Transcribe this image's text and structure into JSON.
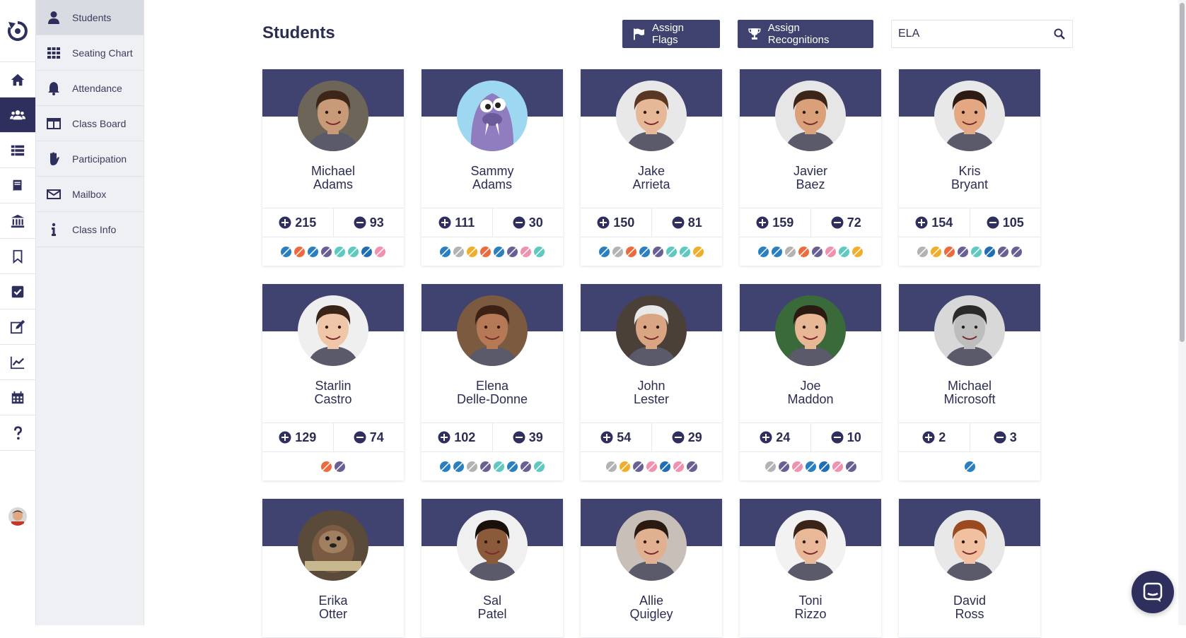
{
  "rail": {
    "items": [
      "home-icon",
      "students-icon",
      "list-icon",
      "book-icon",
      "bank-icon",
      "bookmark-icon",
      "checkbox-icon",
      "edit-icon",
      "chart-icon",
      "calendar-icon",
      "help-icon"
    ],
    "active": "students-icon"
  },
  "subnav": {
    "items": [
      {
        "label": "Students",
        "icon": "person-icon",
        "active": true
      },
      {
        "label": "Seating Chart",
        "icon": "grid-icon"
      },
      {
        "label": "Attendance",
        "icon": "bell-icon"
      },
      {
        "label": "Class Board",
        "icon": "board-icon"
      },
      {
        "label": "Participation",
        "icon": "hand-icon"
      },
      {
        "label": "Mailbox",
        "icon": "mail-icon"
      },
      {
        "label": "Class Info",
        "icon": "info-icon"
      }
    ]
  },
  "header": {
    "title": "Students",
    "assign_flags": "Assign Flags",
    "assign_recognitions": "Assign Recognitions",
    "search_value": "ELA"
  },
  "colors": {
    "navy": "#40426f",
    "dark": "#2f2f5e",
    "b": "#2a7fc1",
    "o": "#ee6a3c",
    "p": "#6a5f95",
    "t": "#5ec9c0",
    "d": "#1f6db5",
    "k": "#f091ae",
    "g": "#b3b3b3",
    "y": "#f2ad2b"
  },
  "students": [
    {
      "first": "Michael",
      "last": "Adams",
      "plus": "215",
      "minus": "93",
      "badges": [
        "b",
        "o",
        "b",
        "p",
        "t",
        "t",
        "d",
        "k"
      ],
      "skin": "#c89a78",
      "hair": "#3d2518",
      "bg": "#6d6658"
    },
    {
      "first": "Sammy",
      "last": "Adams",
      "plus": "111",
      "minus": "30",
      "badges": [
        "b",
        "g",
        "y",
        "o",
        "b",
        "p",
        "k",
        "t"
      ],
      "mascot": true
    },
    {
      "first": "Jake",
      "last": "Arrieta",
      "plus": "150",
      "minus": "81",
      "badges": [
        "b",
        "g",
        "o",
        "b",
        "p",
        "t",
        "t",
        "y"
      ],
      "skin": "#e7b898",
      "hair": "#5a3722",
      "bg": "#e8e8e8"
    },
    {
      "first": "Javier",
      "last": "Baez",
      "plus": "159",
      "minus": "72",
      "badges": [
        "b",
        "b",
        "g",
        "o",
        "p",
        "k",
        "t",
        "y"
      ],
      "skin": "#d9a07a",
      "hair": "#3b2418",
      "bg": "#e6e6e6"
    },
    {
      "first": "Kris",
      "last": "Bryant",
      "plus": "154",
      "minus": "105",
      "badges": [
        "g",
        "y",
        "o",
        "p",
        "t",
        "d",
        "p",
        "p"
      ],
      "skin": "#e3a882",
      "hair": "#2d1a12",
      "bg": "#e8e8e8"
    },
    {
      "first": "Starlin",
      "last": "Castro",
      "plus": "129",
      "minus": "74",
      "badges": [
        "o",
        "p"
      ],
      "skin": "#f0c6a8",
      "hair": "#3a2418",
      "bg": "#efefef"
    },
    {
      "first": "Elena",
      "last": "Delle-Donne",
      "plus": "102",
      "minus": "39",
      "badges": [
        "b",
        "b",
        "g",
        "p",
        "t",
        "b",
        "p",
        "t"
      ],
      "skin": "#b57a55",
      "hair": "#3b2214",
      "bg": "#7b5a40"
    },
    {
      "first": "John",
      "last": "Lester",
      "plus": "54",
      "minus": "29",
      "badges": [
        "g",
        "y",
        "p",
        "k",
        "d",
        "k",
        "p"
      ],
      "skin": "#d9a582",
      "hair": "#e8e8e8",
      "bg": "#4a4038"
    },
    {
      "first": "Joe",
      "last": "Maddon",
      "plus": "24",
      "minus": "10",
      "badges": [
        "g",
        "p",
        "k",
        "b",
        "d",
        "k",
        "p"
      ],
      "skin": "#e8b796",
      "hair": "#2a1a12",
      "bg": "#3a6a3a"
    },
    {
      "first": "Michael",
      "last": "Microsoft",
      "plus": "2",
      "minus": "3",
      "badges": [
        "b"
      ],
      "skin": "#bdbdbd",
      "hair": "#2a2a2a",
      "bg": "#d8d8d8"
    },
    {
      "first": "Erika",
      "last": "Otter",
      "plus": "",
      "minus": "",
      "badges": [],
      "otter": true
    },
    {
      "first": "Sal",
      "last": "Patel",
      "plus": "",
      "minus": "",
      "badges": [],
      "skin": "#8a5a3a",
      "hair": "#1a100a",
      "bg": "#f0f0f0"
    },
    {
      "first": "Allie",
      "last": "Quigley",
      "plus": "",
      "minus": "",
      "badges": [],
      "skin": "#e0b090",
      "hair": "#2a1a12",
      "bg": "#c8c0b8"
    },
    {
      "first": "Toni",
      "last": "Rizzo",
      "plus": "",
      "minus": "",
      "badges": [],
      "skin": "#e8b898",
      "hair": "#3a2418",
      "bg": "#f2f2f2"
    },
    {
      "first": "David",
      "last": "Ross",
      "plus": "",
      "minus": "",
      "badges": [],
      "skin": "#f0c0a0",
      "hair": "#9a4a20",
      "bg": "#e8e8e8"
    }
  ]
}
